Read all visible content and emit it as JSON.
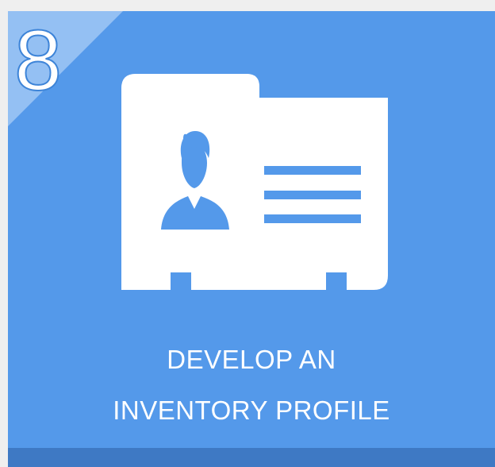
{
  "tile": {
    "step_number": "8",
    "title_line_1": "DEVELOP AN",
    "title_line_2": "INVENTORY PROFILE",
    "icon": "id-card-icon"
  },
  "colors": {
    "tile_background": "#5499ea",
    "corner_highlight": "#94c0f3",
    "footer_bar": "#3e79c4",
    "text": "#ffffff"
  }
}
